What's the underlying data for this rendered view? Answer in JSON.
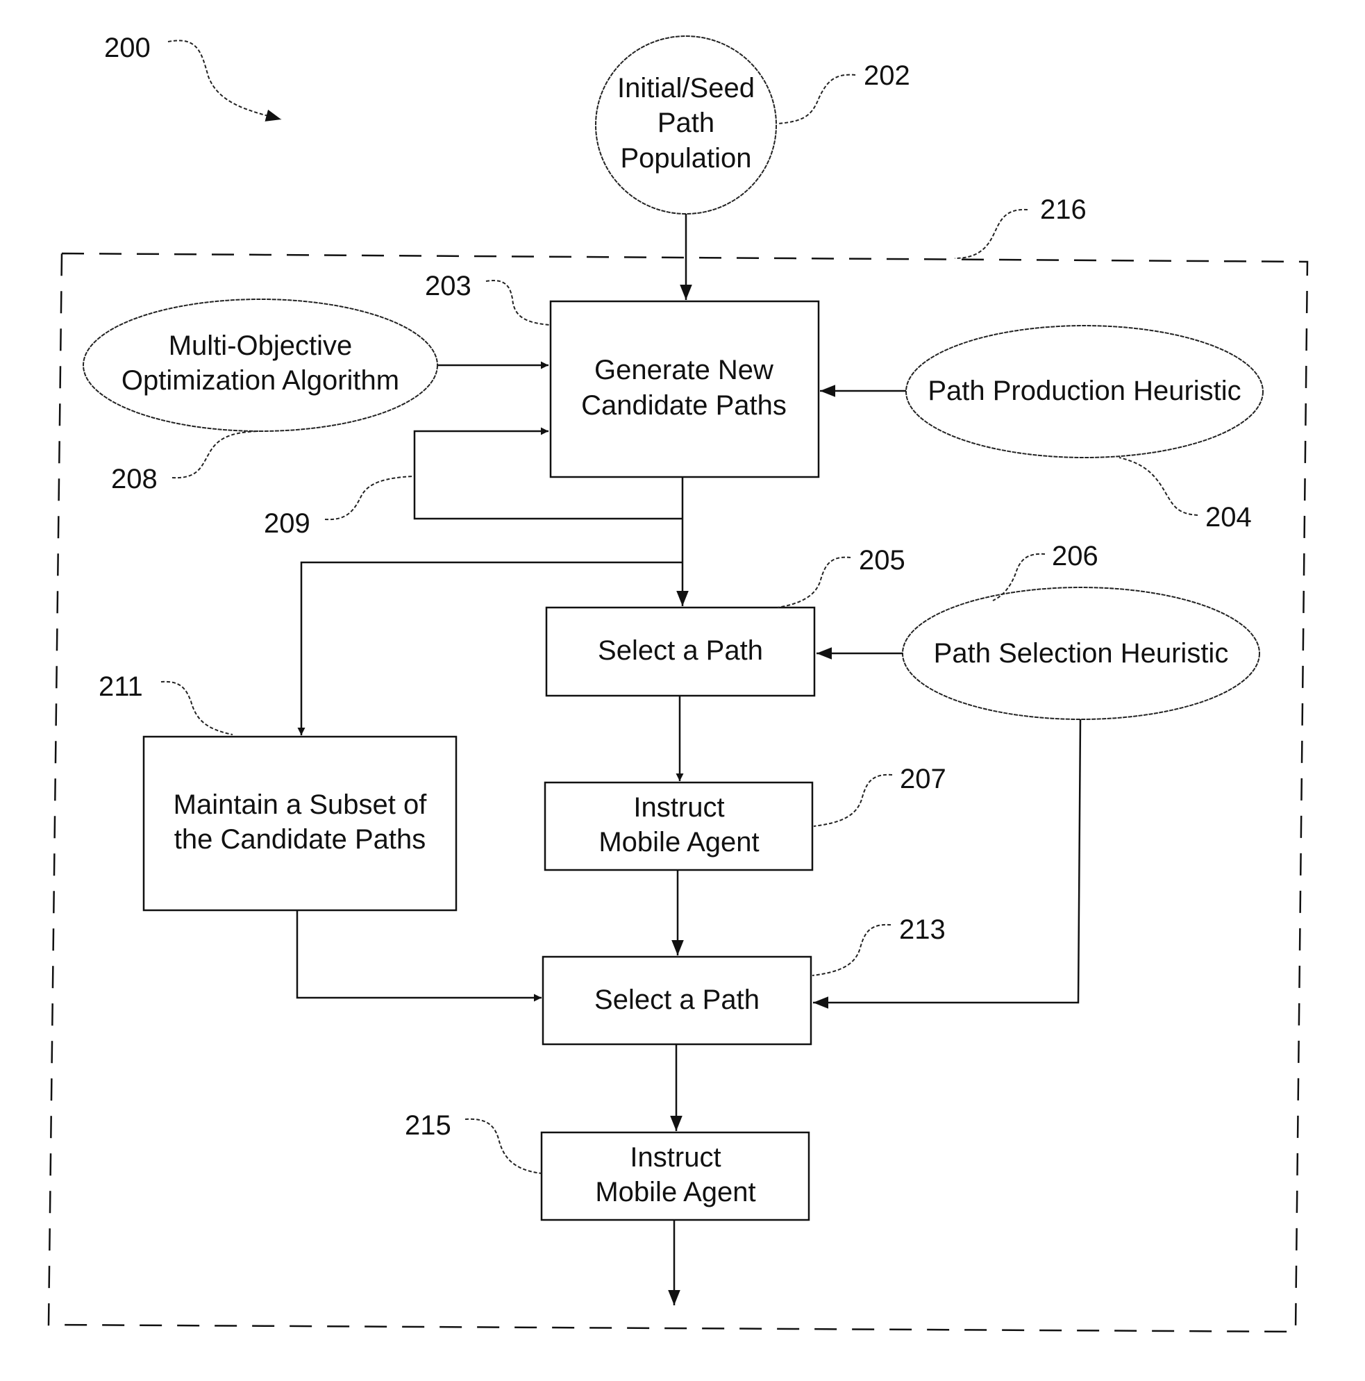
{
  "figure": {
    "ref": "200",
    "boundary_ref": "216"
  },
  "nodes": {
    "seed": {
      "ref": "202",
      "lines": [
        "Initial/Seed",
        "Path",
        "Population"
      ]
    },
    "generate": {
      "ref": "203",
      "lines": [
        "Generate New",
        "Candidate Paths"
      ]
    },
    "production_heuristic": {
      "ref": "204",
      "lines": [
        "Path Production Heuristic"
      ]
    },
    "select1": {
      "ref": "205",
      "lines": [
        "Select a Path"
      ]
    },
    "selection_heuristic": {
      "ref": "206",
      "lines": [
        "Path Selection Heuristic"
      ]
    },
    "instruct1": {
      "ref": "207",
      "lines": [
        "Instruct",
        "Mobile Agent"
      ]
    },
    "moo": {
      "ref": "208",
      "lines": [
        "Multi-Objective",
        "Optimization Algorithm"
      ]
    },
    "loop": {
      "ref": "209"
    },
    "maintain": {
      "ref": "211",
      "lines": [
        "Maintain a Subset of",
        "the Candidate Paths"
      ]
    },
    "select2": {
      "ref": "213",
      "lines": [
        "Select a Path"
      ]
    },
    "instruct2": {
      "ref": "215",
      "lines": [
        "Instruct",
        "Mobile Agent"
      ]
    }
  }
}
